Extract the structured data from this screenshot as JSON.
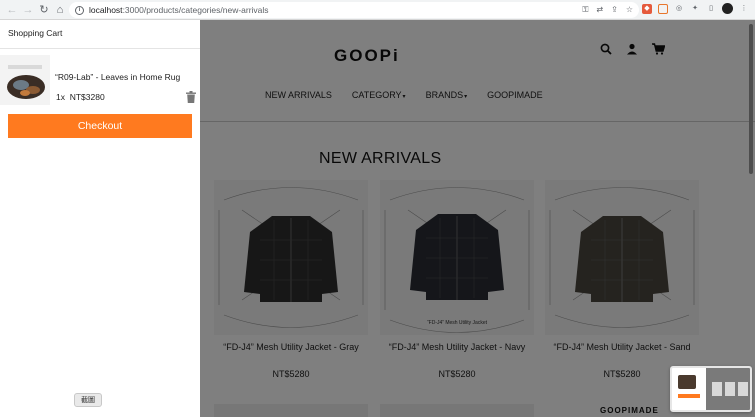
{
  "browser": {
    "url_host": "localhost",
    "url_path": ":3000/products/categories/new-arrivals"
  },
  "site": {
    "logo": "GOOPi",
    "nav": [
      {
        "label": "NEW ARRIVALS",
        "has_caret": false
      },
      {
        "label": "CATEGORY",
        "has_caret": true
      },
      {
        "label": "BRANDS",
        "has_caret": true
      },
      {
        "label": "GOOPIMADE",
        "has_caret": false
      }
    ],
    "caret": "▾",
    "section_title": "NEW ARRIVALS",
    "products": [
      {
        "name": "“FD-J4” Mesh Utility Jacket - Gray",
        "price": "NT$5280",
        "color": "#2f2f2f"
      },
      {
        "name": "“FD-J4” Mesh Utility Jacket - Navy",
        "price": "NT$5280",
        "color": "#2a2d34",
        "caption": "“FD-J4” Mesh Utility Jacket"
      },
      {
        "name": "“FD-J4” Mesh Utility Jacket - Sand",
        "price": "NT$5280",
        "color": "#4a473e"
      }
    ],
    "bottom_logo": "GOOPIMADE"
  },
  "cart": {
    "title": "Shopping Cart",
    "items": [
      {
        "name": "“R09-Lab” - Leaves in Home Rug",
        "qty": "1x",
        "price": "NT$3280"
      }
    ],
    "checkout_label": "Checkout"
  },
  "tooltip": "截圖",
  "colors": {
    "accent": "#ff7a1f",
    "overlay": "rgba(0,0,0,0.5)"
  }
}
